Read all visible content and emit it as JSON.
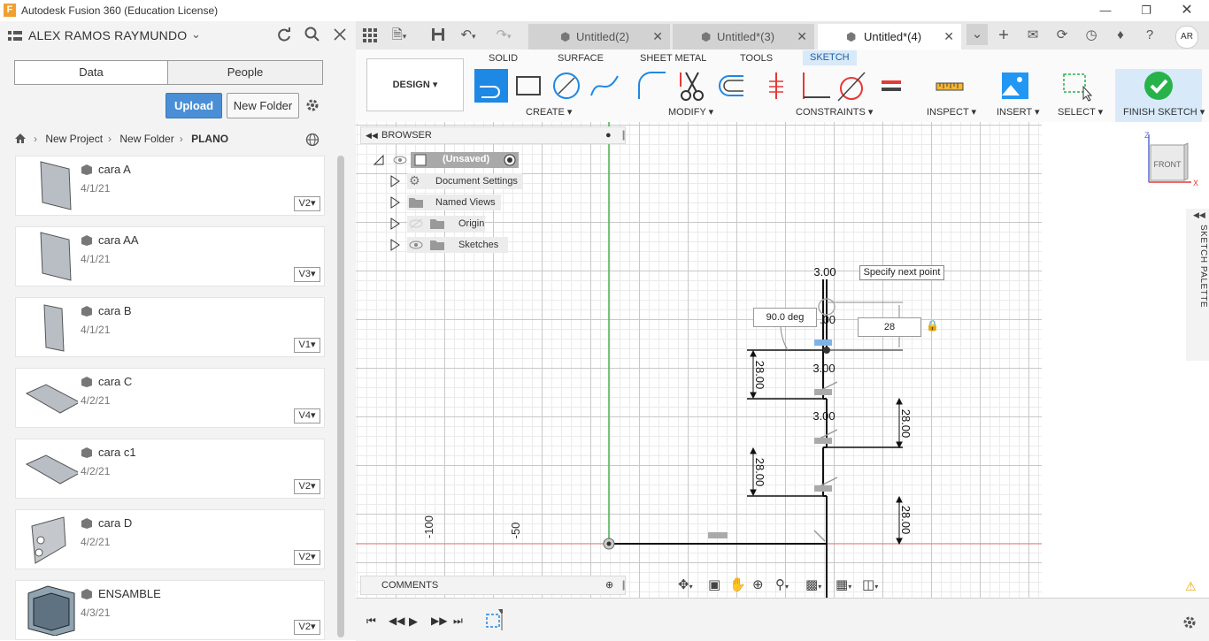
{
  "window": {
    "title": "Autodesk Fusion 360 (Education License)",
    "app_icon": "F"
  },
  "data_panel": {
    "user": "ALEX RAMOS RAYMUNDO",
    "tabs": [
      "Data",
      "People"
    ],
    "upload_label": "Upload",
    "new_folder_label": "New Folder",
    "breadcrumb": [
      "New Project",
      "New Folder",
      "PLANO"
    ],
    "files": [
      {
        "name": "cara A",
        "date": "4/1/21",
        "version": "V2"
      },
      {
        "name": "cara AA",
        "date": "4/1/21",
        "version": "V3"
      },
      {
        "name": "cara B",
        "date": "4/1/21",
        "version": "V1"
      },
      {
        "name": "cara C",
        "date": "4/2/21",
        "version": "V4"
      },
      {
        "name": "cara c1",
        "date": "4/2/21",
        "version": "V2"
      },
      {
        "name": "cara D",
        "date": "4/2/21",
        "version": "V2"
      },
      {
        "name": "ENSAMBLE",
        "date": "4/3/21",
        "version": "V2"
      }
    ]
  },
  "doc_tabs": [
    {
      "label": "Untitled(2)"
    },
    {
      "label": "Untitled*(3)"
    },
    {
      "label": "Untitled*(4)",
      "active": true
    }
  ],
  "user_initials": "AR",
  "ribbon": {
    "workspace": "DESIGN",
    "tabs": [
      "SOLID",
      "SURFACE",
      "SHEET METAL",
      "TOOLS",
      "SKETCH"
    ],
    "active_tab": "SKETCH",
    "groups": [
      "CREATE",
      "MODIFY",
      "CONSTRAINTS",
      "INSPECT",
      "INSERT",
      "SELECT"
    ],
    "finish_label": "FINISH SKETCH"
  },
  "browser": {
    "title": "BROWSER",
    "root": "(Unsaved)",
    "items": [
      "Document Settings",
      "Named Views",
      "Origin",
      "Sketches"
    ]
  },
  "comments_label": "COMMENTS",
  "sketch": {
    "tooltip": "Specify next point",
    "angle_input": "90.0 deg",
    "length_input": "28",
    "dims_300": [
      "3.00",
      "3.00",
      "3.00"
    ],
    "dim_partial": ".00",
    "dims_2800": [
      "28.00",
      "28.00",
      "28.00",
      "28.00"
    ],
    "axis_ticks": [
      "-100",
      "-50"
    ]
  },
  "viewcube_label": "FRONT",
  "palette_label": "SKETCH PALETTE",
  "colors": {
    "accent": "#1b5ea7",
    "upload": "#4a8fd6",
    "finish_check": "#27b34a"
  }
}
